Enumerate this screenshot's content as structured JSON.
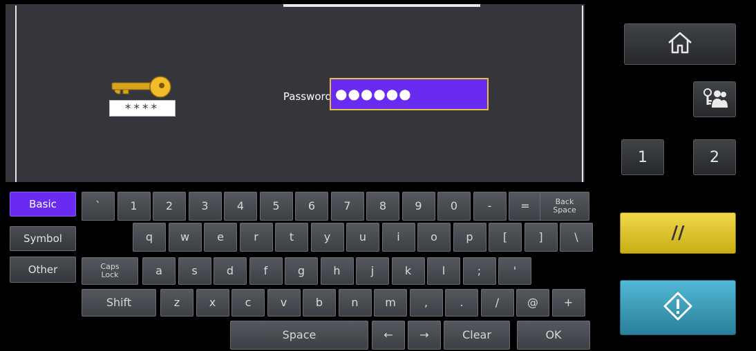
{
  "display": {
    "password_label": "Password",
    "password_value": "●●●●●●",
    "stars": "****"
  },
  "keyboard": {
    "modes": [
      "Basic",
      "Symbol",
      "Other"
    ],
    "active_mode": "Basic",
    "row1": [
      "`",
      "1",
      "2",
      "3",
      "4",
      "5",
      "6",
      "7",
      "8",
      "9",
      "0",
      "-",
      "="
    ],
    "backspace": "Back\nSpace",
    "row2": [
      "q",
      "w",
      "e",
      "r",
      "t",
      "y",
      "u",
      "i",
      "o",
      "p",
      "[",
      "]",
      "\\"
    ],
    "caps_lock": "Caps\nLock",
    "row3": [
      "a",
      "s",
      "d",
      "f",
      "g",
      "h",
      "j",
      "k",
      "l",
      ";",
      "'"
    ],
    "shift": "Shift",
    "row4": [
      "z",
      "x",
      "c",
      "v",
      "b",
      "n",
      "m",
      ",",
      ".",
      "/",
      "@",
      "+"
    ],
    "space": "Space",
    "left_arrow": "←",
    "right_arrow": "→",
    "clear": "Clear",
    "ok": "OK"
  },
  "side_panel": {
    "home_icon": "home-icon",
    "user_icon": "users-key-icon",
    "num1": "1",
    "num2": "2",
    "reset_label": "//",
    "start_icon": "start-diamond-icon"
  },
  "colors": {
    "accent_purple": "#6a2bf0",
    "field_border": "#e3c044",
    "reset_yellow": "#e2c52a",
    "start_blue": "#3fa3c0"
  }
}
